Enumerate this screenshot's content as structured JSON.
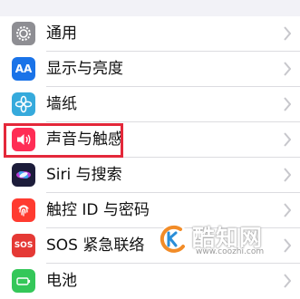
{
  "settings": {
    "items": [
      {
        "label": "通用",
        "icon": "gear-icon",
        "icon_bg": "#8e8e93"
      },
      {
        "label": "显示与亮度",
        "icon": "display-brightness-icon",
        "icon_bg": "#1a73e8",
        "icon_text": "AA"
      },
      {
        "label": "墙纸",
        "icon": "wallpaper-flower-icon",
        "icon_bg": "#36aadc"
      },
      {
        "label": "声音与触感",
        "icon": "speaker-icon",
        "icon_bg": "#ff2d55"
      },
      {
        "label": "Siri 与搜索",
        "icon": "siri-icon",
        "icon_bg": "#1c1c3a"
      },
      {
        "label": "触控 ID 与密码",
        "icon": "fingerprint-icon",
        "icon_bg": "#ff3b30"
      },
      {
        "label": "SOS 紧急联络",
        "icon": "sos-icon",
        "icon_bg": "#e53935",
        "icon_text": "SOS"
      },
      {
        "label": "电池",
        "icon": "battery-icon",
        "icon_bg": "#34c759"
      }
    ]
  },
  "highlight": {
    "color": "#e4283a"
  },
  "watermark": {
    "name": "酷知网",
    "url": "www.coozhi.com"
  }
}
